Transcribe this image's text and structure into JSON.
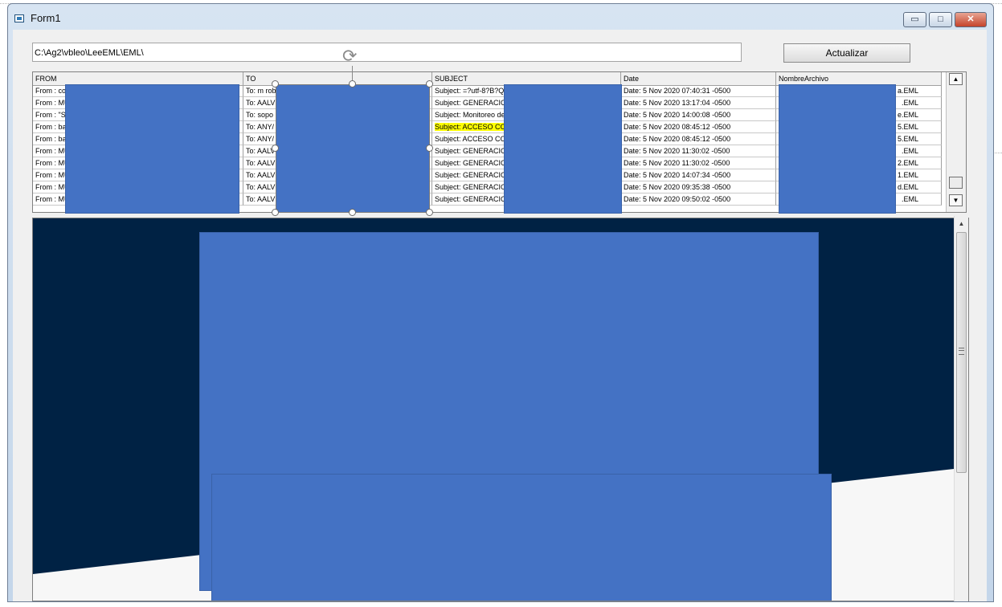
{
  "window": {
    "title": "Form1",
    "controls": {
      "minimize": "▭",
      "maximize": "□",
      "close": "✕"
    }
  },
  "toolbar": {
    "path_value": "C:\\Ag2\\vbleo\\LeeEML\\EML\\",
    "refresh_label": "Actualizar"
  },
  "grid": {
    "headers": [
      "FROM",
      "TO",
      "SUBJECT",
      "Date",
      "NombreArchivo"
    ],
    "rows": [
      {
        "from": "From : co",
        "to": "To: m rob",
        "subject": "Subject: =?utf-8?B?Q",
        "date": "Date: 5 Nov 2020 07:40:31 -0500",
        "file": "a.EML"
      },
      {
        "from": "From : MU",
        "to": "To: AALV",
        "subject": "Subject: GENERACIO",
        "date": "Date: 5 Nov 2020 13:17:04 -0500",
        "file": ".EML"
      },
      {
        "from": "From : \"S",
        "to": "To: sopo",
        "subject": "Subject: Monitoreo de",
        "date": "Date: 5 Nov 2020 14:00:08 -0500",
        "file": "e.EML"
      },
      {
        "from": "From : ba",
        "to": "To: ANY/",
        "subject": "Subject: ACCESO CO",
        "date": "Date: 5 Nov 2020 08:45:12 -0500",
        "file": "5.EML",
        "highlight": true
      },
      {
        "from": "From : ba",
        "to": "To: ANY/",
        "subject": "Subject: ACCESO CO",
        "date": "Date: 5 Nov 2020 08:45:12 -0500",
        "file": "5.EML"
      },
      {
        "from": "From : MU",
        "to": "To: AALV",
        "subject": "Subject: GENERACIO",
        "date": "Date: 5 Nov 2020 11:30:02 -0500",
        "file": ".EML"
      },
      {
        "from": "From : MU",
        "to": "To: AALV",
        "subject": "Subject: GENERACIO",
        "date": "Date: 5 Nov 2020 11:30:02 -0500",
        "file": "2.EML"
      },
      {
        "from": "From : MU",
        "to": "To: AALV",
        "subject": "Subject: GENERACIO",
        "date": "Date: 5 Nov 2020 14:07:34 -0500",
        "file": "1.EML"
      },
      {
        "from": "From : MU",
        "to": "To: AALV",
        "subject": "Subject: GENERACIO",
        "date": "Date: 5 Nov 2020 09:35:38 -0500",
        "file": "d.EML"
      },
      {
        "from": "From : MU",
        "to": "To: AALV",
        "subject": "Subject: GENERACIO",
        "date": "Date: 5 Nov 2020 09:50:02 -0500",
        "file": ".EML"
      }
    ],
    "highlight_color": "#ffff00"
  },
  "scrollbar_icons": {
    "up": "▲",
    "down": "▼",
    "grip": "≡"
  },
  "colors": {
    "redaction": "#4472c4",
    "preview_banner": "#002244",
    "preview_background": "#f7f7f7"
  }
}
